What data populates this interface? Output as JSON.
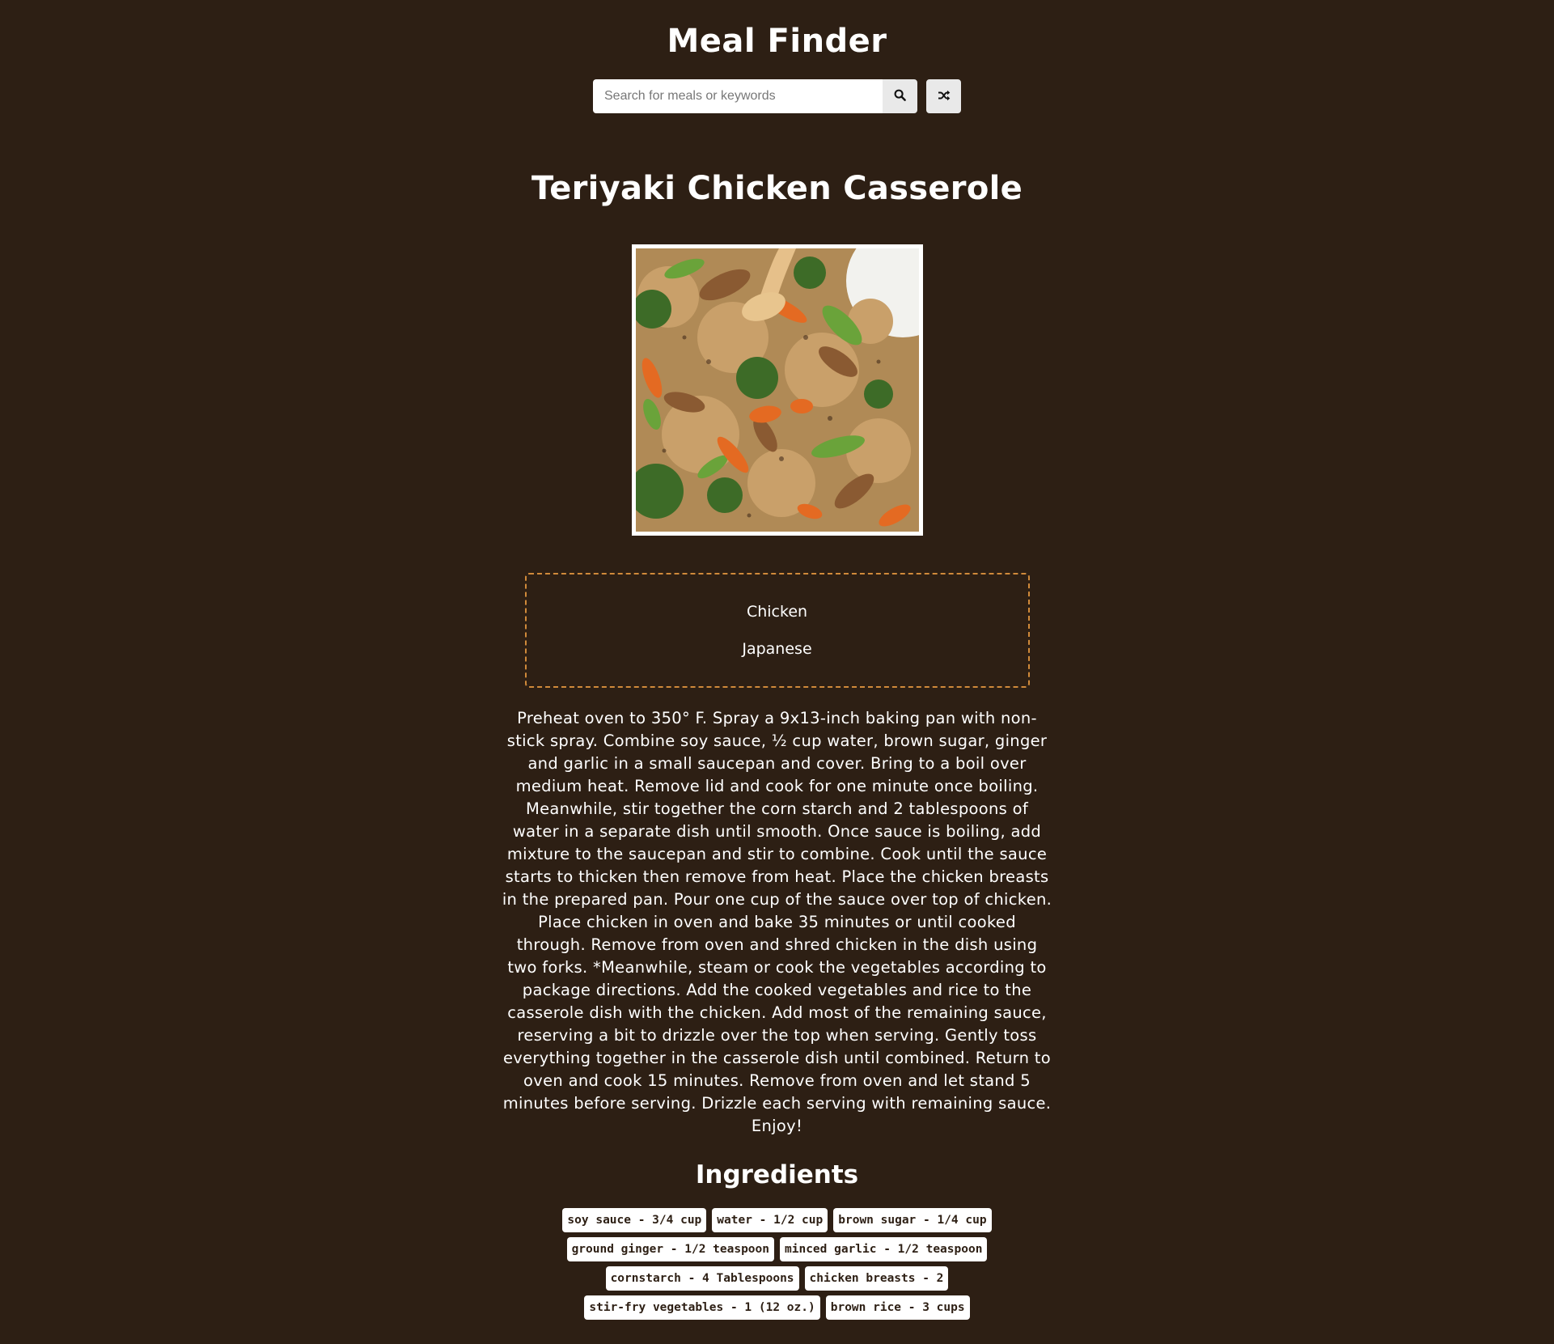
{
  "app": {
    "title": "Meal Finder"
  },
  "search": {
    "placeholder": "Search for meals or keywords",
    "value": "",
    "submit_icon": "search-icon",
    "random_icon": "shuffle-icon"
  },
  "meal": {
    "title": "Teriyaki Chicken Casserole",
    "category": "Chicken",
    "area": "Japanese",
    "instructions": "Preheat oven to 350° F. Spray a 9x13-inch baking pan with non-stick spray. Combine soy sauce, ½ cup water, brown sugar, ginger and garlic in a small saucepan and cover. Bring to a boil over medium heat. Remove lid and cook for one minute once boiling. Meanwhile, stir together the corn starch and 2 tablespoons of water in a separate dish until smooth. Once sauce is boiling, add mixture to the saucepan and stir to combine. Cook until the sauce starts to thicken then remove from heat. Place the chicken breasts in the prepared pan. Pour one cup of the sauce over top of chicken. Place chicken in oven and bake 35 minutes or until cooked through. Remove from oven and shred chicken in the dish using two forks. *Meanwhile, steam or cook the vegetables according to package directions. Add the cooked vegetables and rice to the casserole dish with the chicken. Add most of the remaining sauce, reserving a bit to drizzle over the top when serving. Gently toss everything together in the casserole dish until combined. Return to oven and cook 15 minutes. Remove from oven and let stand 5 minutes before serving. Drizzle each serving with remaining sauce. Enjoy!",
    "ingredients_title": "Ingredients",
    "ingredients": [
      "soy sauce - 3/4 cup",
      "water - 1/2 cup",
      "brown sugar - 1/4 cup",
      "ground ginger - 1/2 teaspoon",
      "minced garlic - 1/2 teaspoon",
      "cornstarch - 4 Tablespoons",
      "chicken breasts - 2",
      "stir-fry vegetables - 1 (12 oz.)",
      "brown rice - 3 cups"
    ]
  },
  "colors": {
    "background": "#2d1f14",
    "accent_border": "#d08a3a",
    "text": "#ffffff",
    "button_bg": "#e9e9e9"
  }
}
